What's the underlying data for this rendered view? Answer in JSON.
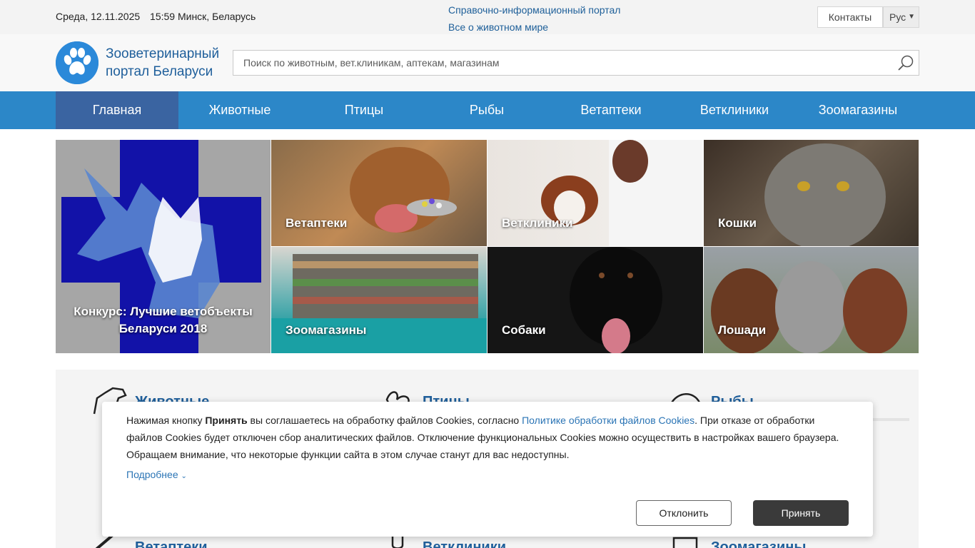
{
  "topbar": {
    "date": "Среда, 12.11.2025",
    "time_location": "15:59 Минск, Беларусь",
    "portal_line1": "Справочно-информационный портал",
    "portal_line2": "Все о животном мире",
    "contacts_label": "Контакты",
    "language": "Рус"
  },
  "header": {
    "logo_line1": "Зооветеринарный",
    "logo_line2": "портал Беларуси",
    "search_placeholder": "Поиск по животным, вет.клиникам, аптекам, магазинам"
  },
  "nav": {
    "items": [
      {
        "label": "Главная",
        "active": true
      },
      {
        "label": "Животные"
      },
      {
        "label": "Птицы"
      },
      {
        "label": "Рыбы"
      },
      {
        "label": "Ветаптеки"
      },
      {
        "label": "Ветклиники"
      },
      {
        "label": "Зоомагазины"
      }
    ]
  },
  "tiles": {
    "big": {
      "line1": "Конкурс: Лучшие ветобъекты",
      "line2": "Беларуси 2018"
    },
    "items": [
      {
        "label": "Ветаптеки"
      },
      {
        "label": "Ветклиники"
      },
      {
        "label": "Кошки"
      },
      {
        "label": "Зоомагазины"
      },
      {
        "label": "Собаки"
      },
      {
        "label": "Лошади"
      }
    ]
  },
  "categories": {
    "row1": [
      {
        "label": "Животные"
      },
      {
        "label": "Птицы"
      },
      {
        "label": "Рыбы"
      }
    ],
    "row2": [
      {
        "label": "Ветаптеки"
      },
      {
        "label": "Ветклиники"
      },
      {
        "label": "Зоомагазины"
      }
    ]
  },
  "cookie": {
    "text_before": "Нажимая кнопку ",
    "text_bold": "Принять",
    "text_middle": " вы соглашаетесь на обработку файлов Cookies, согласно ",
    "policy_link": "Политике обработки файлов Cookies",
    "text_after": ". При отказе от обработки файлов Cookies будет отключен сбор аналитических файлов. Отключение функциональных Cookies можно осуществить в настройках вашего браузера. Обращаем внимание, что некоторые функции сайта в этом случае станут для вас недоступны.",
    "more_label": "Подробнее",
    "decline_label": "Отклонить",
    "accept_label": "Принять"
  },
  "colors": {
    "brand_blue": "#2c87c8",
    "nav_active": "#3a64a1",
    "link_blue": "#1e5f99"
  }
}
